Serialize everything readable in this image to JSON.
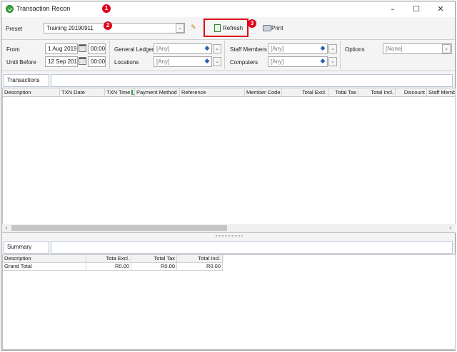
{
  "window": {
    "title": "Transaction Recon",
    "controls": {
      "minimize": "–",
      "maximize": "☐",
      "close": "✕"
    }
  },
  "annotations": [
    "1",
    "2",
    "3"
  ],
  "preset": {
    "label": "Preset",
    "value": "Training 20190911"
  },
  "toolbar": {
    "refresh_label": "Refresh",
    "print_label": "Print"
  },
  "filters": {
    "from_label": "From",
    "from_date": "1 Aug 2019",
    "from_time": "00:00",
    "until_label": "Until Before",
    "until_date": "12 Sep 2019",
    "until_time": "00:00",
    "general_ledgers_label": "General Ledgers",
    "general_ledgers_value": "[Any]",
    "locations_label": "Locations",
    "locations_value": "[Any]",
    "staff_members_label": "Staff Members",
    "staff_members_value": "[Any]",
    "computers_label": "Computers",
    "computers_value": "[Any]",
    "options_label": "Options",
    "options_value": "[None]"
  },
  "transactions": {
    "tab_label": "Transactions",
    "columns": [
      "Description",
      "TXN Date",
      "TXN Time",
      "Payment Method",
      "Reference",
      "Member Code",
      "Total Excl.",
      "Total Tax",
      "Total Incl.",
      "Discount",
      "Staff Membe"
    ]
  },
  "summary": {
    "tab_label": "Summary",
    "columns": [
      "Description",
      "Tota Excl.",
      "Total Tax",
      "Total Incl."
    ],
    "rows": [
      [
        "Grand Total",
        "R0.00",
        "R0.00",
        "R0.00"
      ]
    ]
  },
  "icons": {
    "app": "green-check-icon",
    "edit": "pencil-eraser-icon",
    "refresh": "refresh-sheet-icon",
    "print": "printer-icon",
    "calendar": "calendar-icon",
    "sort": "sort-ascending-icon"
  },
  "colors": {
    "annotation": "#e0001a",
    "highlight_border": "#e0001a",
    "tab_border": "#b9c7d9"
  }
}
